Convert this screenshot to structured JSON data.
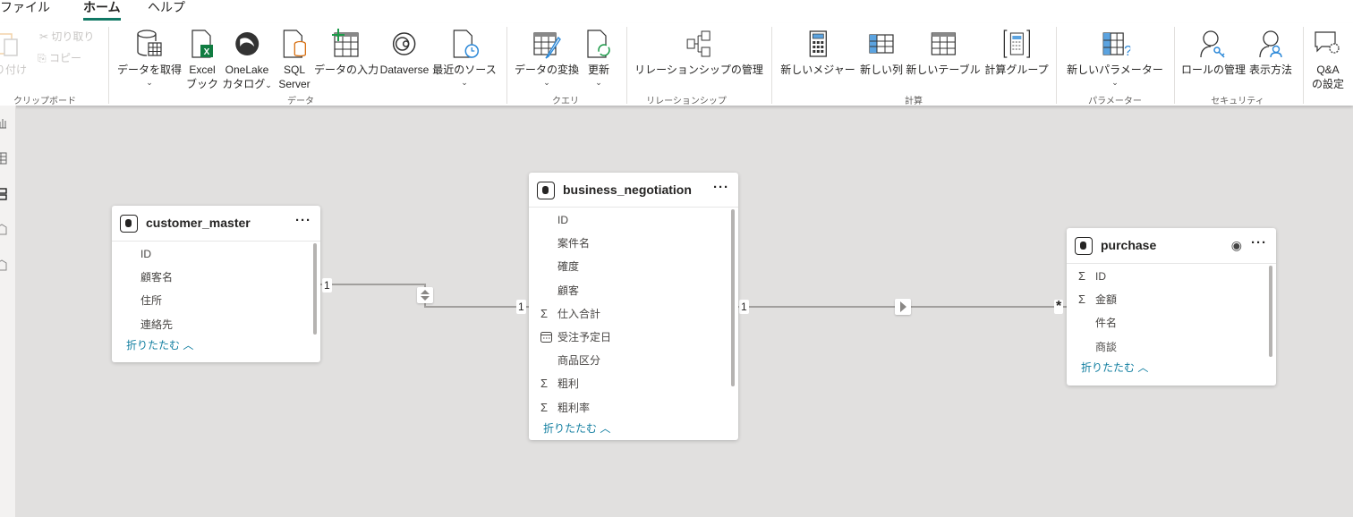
{
  "menu": {
    "tabs": [
      {
        "label": "ファイル"
      },
      {
        "label": "ホーム",
        "active": true
      },
      {
        "label": "ヘルプ"
      }
    ]
  },
  "ribbon": {
    "clipboard": {
      "paste": "り付け",
      "cut": "切り取り",
      "copy": "コピー",
      "group": "クリップボード"
    },
    "data": {
      "get_data": "データを取得",
      "excel_1": "Excel",
      "excel_2": "ブック",
      "onelake_1": "OneLake",
      "onelake_2": "カタログ",
      "sql_1": "SQL",
      "sql_2": "Server",
      "enter_data": "データの入力",
      "dataverse": "Dataverse",
      "recent": "最近のソース",
      "group": "データ"
    },
    "query": {
      "transform": "データの変換",
      "refresh": "更新",
      "group": "クエリ"
    },
    "relationships": {
      "manage": "リレーションシップの管理",
      "group": "リレーションシップ"
    },
    "calc": {
      "measure": "新しいメジャー",
      "column": "新しい列",
      "table": "新しいテーブル",
      "calc_group": "計算グループ",
      "group": "計算"
    },
    "params": {
      "new_param": "新しいパラメーター",
      "group": "パラメーター"
    },
    "security": {
      "manage_roles": "ロールの管理",
      "view_as": "表示方法",
      "group": "セキュリティ"
    },
    "qa": {
      "label_1": "Q&A",
      "label_2": "の設定"
    },
    "chevron": "⌄"
  },
  "tables": [
    {
      "name": "customer_master",
      "fields": [
        {
          "name": "ID",
          "icon": ""
        },
        {
          "name": "顧客名",
          "icon": ""
        },
        {
          "name": "住所",
          "icon": ""
        },
        {
          "name": "連絡先",
          "icon": ""
        }
      ],
      "collapse": "折りたたむ ︿"
    },
    {
      "name": "business_negotiation",
      "fields": [
        {
          "name": "ID",
          "icon": ""
        },
        {
          "name": "案件名",
          "icon": ""
        },
        {
          "name": "確度",
          "icon": ""
        },
        {
          "name": "顧客",
          "icon": ""
        },
        {
          "name": "仕入合計",
          "icon": "Σ"
        },
        {
          "name": "受注予定日",
          "icon": "📅"
        },
        {
          "name": "商品区分",
          "icon": ""
        },
        {
          "name": "粗利",
          "icon": "Σ"
        },
        {
          "name": "粗利率",
          "icon": "Σ"
        }
      ],
      "collapse": "折りたたむ ︿"
    },
    {
      "name": "purchase",
      "fields": [
        {
          "name": "ID",
          "icon": "Σ"
        },
        {
          "name": "金額",
          "icon": "Σ"
        },
        {
          "name": "件名",
          "icon": ""
        },
        {
          "name": "商談",
          "icon": ""
        }
      ],
      "collapse": "折りたたむ ︿"
    }
  ],
  "relationships": [
    {
      "from": "customer_master",
      "to": "business_negotiation",
      "from_card": "1",
      "to_card": "1",
      "direction": "both"
    },
    {
      "from": "business_negotiation",
      "to": "purchase",
      "from_card": "1",
      "to_card": "*",
      "direction": "single"
    }
  ],
  "colors": {
    "accent": "#117865",
    "link": "#117ea0",
    "canvas": "#e1e0df"
  }
}
